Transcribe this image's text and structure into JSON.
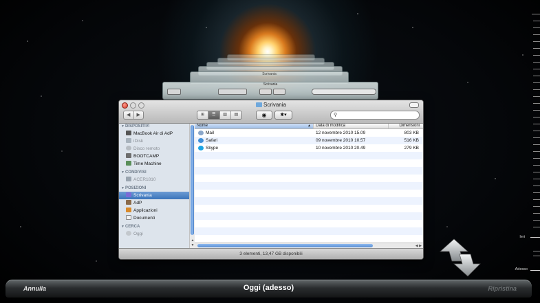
{
  "finder": {
    "title": "Scrivania",
    "search_placeholder": "",
    "nav": {
      "back": "◀",
      "forward": "▶"
    },
    "view_modes": [
      "⊞",
      "☰",
      "▥",
      "▤"
    ],
    "sidebar": {
      "sections": [
        {
          "label": "DISPOSITIVI",
          "items": [
            {
              "label": "MacBook Air di AdP",
              "dim": false,
              "selected": false,
              "icon": "laptop-icon"
            },
            {
              "label": "iDisk",
              "dim": true,
              "selected": false,
              "icon": "idisk-icon"
            },
            {
              "label": "Disco remoto",
              "dim": true,
              "selected": false,
              "icon": "disc-icon"
            },
            {
              "label": "BOOTCAMP",
              "dim": false,
              "selected": false,
              "icon": "drive-icon"
            },
            {
              "label": "Time Machine",
              "dim": false,
              "selected": false,
              "icon": "drive-icon"
            }
          ]
        },
        {
          "label": "CONDIVISI",
          "items": [
            {
              "label": "ACER1810",
              "dim": true,
              "selected": false,
              "icon": "pc-icon"
            }
          ]
        },
        {
          "label": "POSIZIONI",
          "items": [
            {
              "label": "Scrivania",
              "dim": false,
              "selected": true,
              "icon": "desktop-icon"
            },
            {
              "label": "AdP",
              "dim": false,
              "selected": false,
              "icon": "home-icon"
            },
            {
              "label": "Applicazioni",
              "dim": false,
              "selected": false,
              "icon": "apps-icon"
            },
            {
              "label": "Documenti",
              "dim": false,
              "selected": false,
              "icon": "documents-icon"
            }
          ]
        },
        {
          "label": "CERCA",
          "items": [
            {
              "label": "Oggi",
              "dim": true,
              "selected": false,
              "icon": "clock-icon"
            }
          ]
        }
      ]
    },
    "columns": {
      "name": "Nome",
      "date": "Data di modifica",
      "size": "Dimensioni"
    },
    "files": [
      {
        "name": "Mail",
        "date": "12 novembre 2010 15.09",
        "size": "803 KB",
        "icon": "mail-app-icon",
        "color": "#8aa6c9"
      },
      {
        "name": "Safari",
        "date": "09 novembre 2010 10.57",
        "size": "516 KB",
        "icon": "safari-app-icon",
        "color": "#3f8fd8"
      },
      {
        "name": "Skype",
        "date": "10 novembre 2010 20.49",
        "size": "279 KB",
        "icon": "skype-app-icon",
        "color": "#1ba4e3"
      }
    ],
    "status": "3 elementi, 13,47 GB disponibili"
  },
  "time_machine": {
    "cancel_label": "Annulla",
    "restore_label": "Ripristina",
    "current_label": "Oggi (adesso)",
    "timeline": {
      "yesterday": "Ieri",
      "now": "Adesso"
    }
  },
  "colors": {
    "selection": "#3b74bb",
    "accent": "#5a8fd2"
  }
}
